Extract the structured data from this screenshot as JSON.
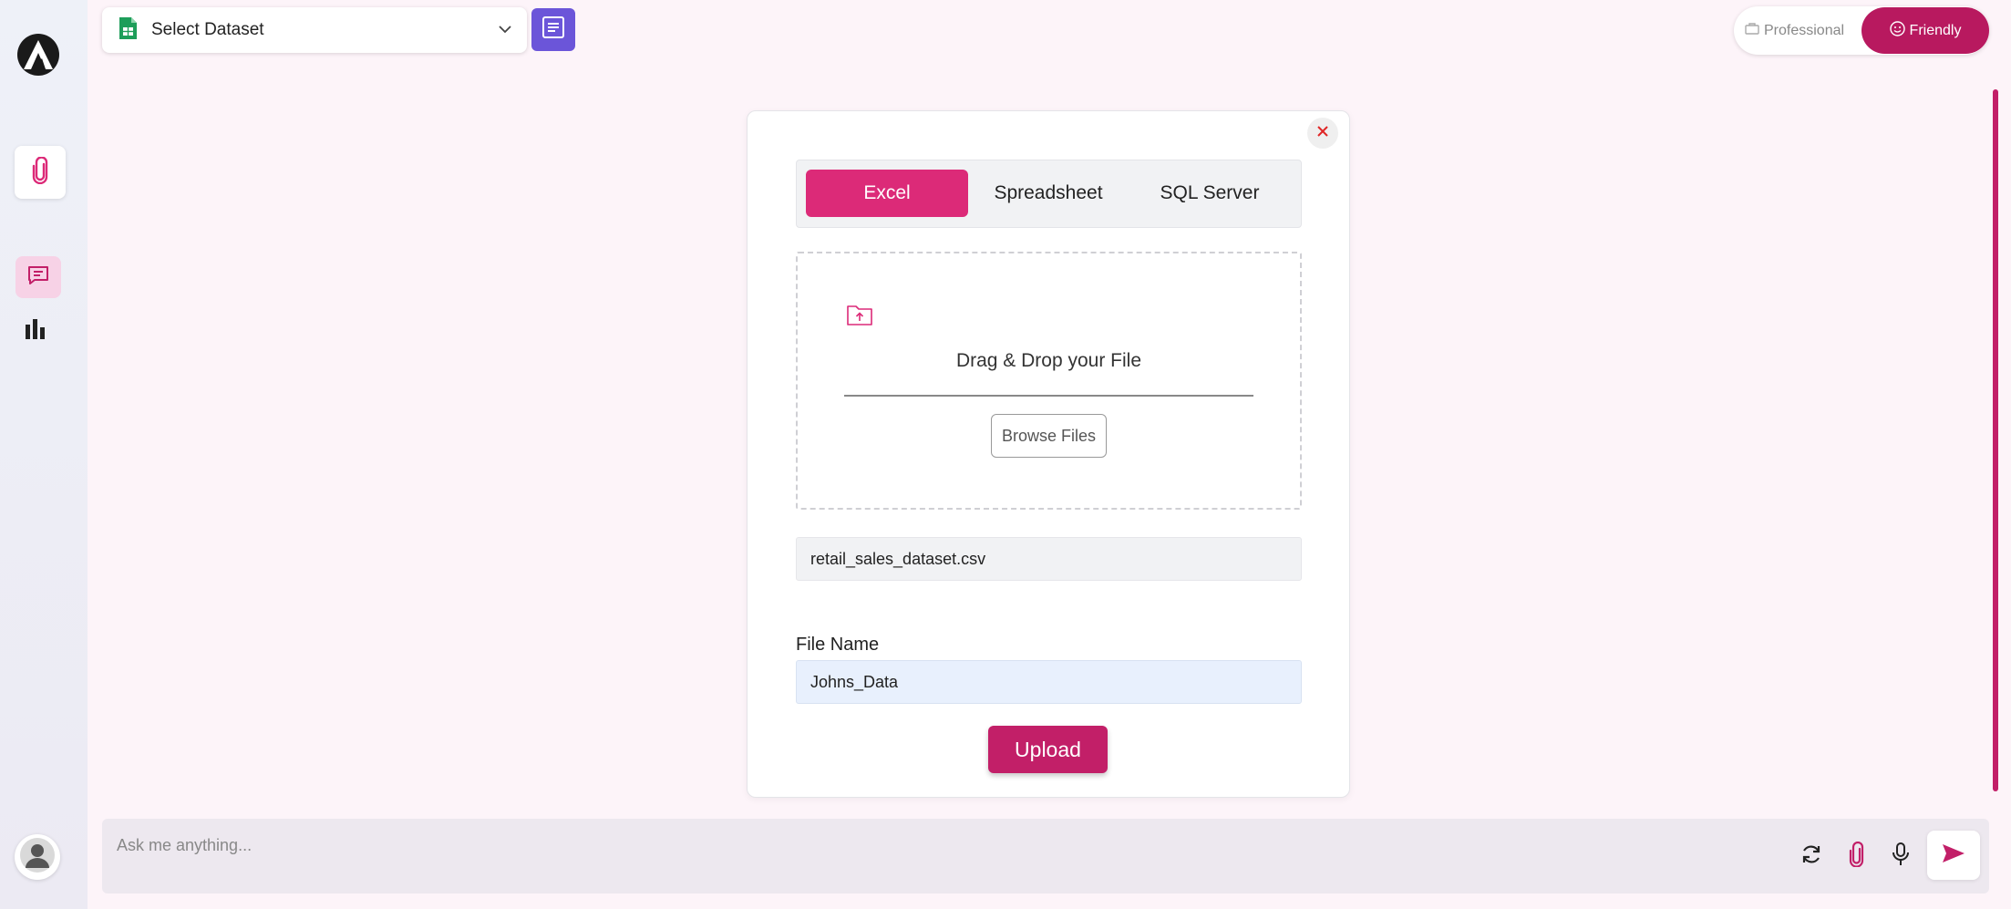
{
  "sidebar": {
    "logo_icon": "app-logo",
    "attach_icon": "paperclip-icon",
    "chat_icon": "chat-icon",
    "analytics_icon": "bar-chart-icon",
    "avatar_icon": "user-avatar-icon"
  },
  "topbar": {
    "dataset_select": {
      "selected": "Select Dataset",
      "icon": "spreadsheet-icon"
    },
    "doc_button_icon": "document-icon",
    "mode": {
      "professional_label": "Professional",
      "friendly_label": "Friendly",
      "active": "Friendly"
    }
  },
  "modal": {
    "tabs": [
      "Excel",
      "Spreadsheet",
      "SQL Server"
    ],
    "active_tab": "Excel",
    "drop_text": "Drag & Drop your File",
    "browse_label": "Browse Files",
    "selected_file": "retail_sales_dataset.csv",
    "file_name_label": "File Name",
    "file_name_value": "Johns_Data",
    "upload_label": "Upload"
  },
  "chat": {
    "placeholder": "Ask me anything..."
  },
  "colors": {
    "accent": "#c21f68",
    "tab_active": "#dc2a78",
    "doc_button": "#6b55d9"
  }
}
